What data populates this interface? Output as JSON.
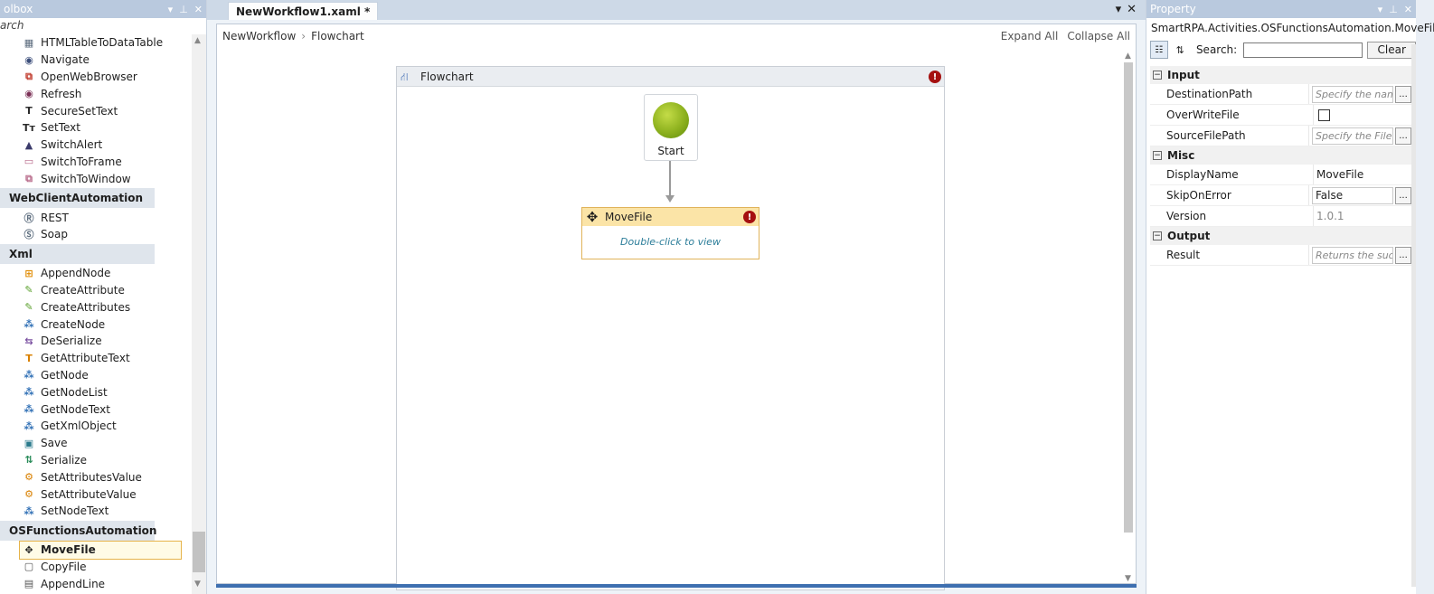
{
  "toolbox": {
    "title": "olbox",
    "search_placeholder": "arch",
    "items": [
      {
        "type": "item",
        "label": "HTMLTableToDataTable",
        "icon": "table-icon",
        "glyph": "▦",
        "color": "#5b6b7d"
      },
      {
        "type": "item",
        "label": "Navigate",
        "icon": "navigate-icon",
        "glyph": "◉",
        "color": "#3b4d7a"
      },
      {
        "type": "item",
        "label": "OpenWebBrowser",
        "icon": "browser-icon",
        "glyph": "⧉",
        "color": "#c0392b"
      },
      {
        "type": "item",
        "label": "Refresh",
        "icon": "refresh-icon",
        "glyph": "◉",
        "color": "#7a2f55"
      },
      {
        "type": "item",
        "label": "SecureSetText",
        "icon": "secure-text-icon",
        "glyph": "T",
        "color": "#2b2b2b"
      },
      {
        "type": "item",
        "label": "SetText",
        "icon": "settext-icon",
        "glyph": "Tт",
        "color": "#2b2b2b"
      },
      {
        "type": "item",
        "label": "SwitchAlert",
        "icon": "alert-icon",
        "glyph": "▲",
        "color": "#3b3b6b"
      },
      {
        "type": "item",
        "label": "SwitchToFrame",
        "icon": "frame-icon",
        "glyph": "▭",
        "color": "#b86a8a"
      },
      {
        "type": "item",
        "label": "SwitchToWindow",
        "icon": "window-icon",
        "glyph": "⧉",
        "color": "#b86a8a"
      },
      {
        "type": "category",
        "label": "WebClientAutomation"
      },
      {
        "type": "item",
        "label": "REST",
        "icon": "rest-icon",
        "glyph": "Ⓡ",
        "color": "#5f6f80"
      },
      {
        "type": "item",
        "label": "Soap",
        "icon": "soap-icon",
        "glyph": "Ⓢ",
        "color": "#5f6f80"
      },
      {
        "type": "category",
        "label": "Xml"
      },
      {
        "type": "item",
        "label": "AppendNode",
        "icon": "append-node-icon",
        "glyph": "⊞",
        "color": "#e08a00"
      },
      {
        "type": "item",
        "label": "CreateAttribute",
        "icon": "pencil-icon",
        "glyph": "✎",
        "color": "#5aa02c"
      },
      {
        "type": "item",
        "label": "CreateAttributes",
        "icon": "pencil-icon",
        "glyph": "✎",
        "color": "#5aa02c"
      },
      {
        "type": "item",
        "label": "CreateNode",
        "icon": "node-icon",
        "glyph": "⁂",
        "color": "#2f6fb5"
      },
      {
        "type": "item",
        "label": "DeSerialize",
        "icon": "deserialize-icon",
        "glyph": "⇆",
        "color": "#7a4fa0"
      },
      {
        "type": "item",
        "label": "GetAttributeText",
        "icon": "text-icon",
        "glyph": "T",
        "color": "#d98000"
      },
      {
        "type": "item",
        "label": "GetNode",
        "icon": "node-icon",
        "glyph": "⁂",
        "color": "#2f6fb5"
      },
      {
        "type": "item",
        "label": "GetNodeList",
        "icon": "node-icon",
        "glyph": "⁂",
        "color": "#2f6fb5"
      },
      {
        "type": "item",
        "label": "GetNodeText",
        "icon": "node-icon",
        "glyph": "⁂",
        "color": "#2f6fb5"
      },
      {
        "type": "item",
        "label": "GetXmlObject",
        "icon": "node-icon",
        "glyph": "⁂",
        "color": "#2f6fb5"
      },
      {
        "type": "item",
        "label": "Save",
        "icon": "save-icon",
        "glyph": "▣",
        "color": "#2a7a8c"
      },
      {
        "type": "item",
        "label": "Serialize",
        "icon": "serialize-icon",
        "glyph": "⇅",
        "color": "#2a8c5a"
      },
      {
        "type": "item",
        "label": "SetAttributesValue",
        "icon": "set-attribute-icon",
        "glyph": "⚙",
        "color": "#d98000"
      },
      {
        "type": "item",
        "label": "SetAttributeValue",
        "icon": "set-attribute-icon",
        "glyph": "⚙",
        "color": "#d98000"
      },
      {
        "type": "item",
        "label": "SetNodeText",
        "icon": "node-icon",
        "glyph": "⁂",
        "color": "#2f6fb5"
      },
      {
        "type": "category",
        "label": "OSFunctionsAutomation"
      },
      {
        "type": "item",
        "label": "MoveFile",
        "icon": "move-icon",
        "glyph": "✥",
        "color": "#1e1e1e",
        "selected": true
      },
      {
        "type": "item",
        "label": "CopyFile",
        "icon": "copy-icon",
        "glyph": "▢",
        "color": "#555555"
      },
      {
        "type": "item",
        "label": "AppendLine",
        "icon": "append-line-icon",
        "glyph": "▤",
        "color": "#555555"
      }
    ]
  },
  "designer": {
    "tab_label": "NewWorkflow1.xaml *",
    "breadcrumb": [
      "NewWorkflow",
      "Flowchart"
    ],
    "expand_all": "Expand All",
    "collapse_all": "Collapse All",
    "flowchart_title": "Flowchart",
    "start_label": "Start",
    "activity": {
      "title": "MoveFile",
      "hint": "Double-click to view"
    },
    "error_mark": "!"
  },
  "property": {
    "title": "Property",
    "type_name": "SmartRPA.Activities.OSFunctionsAutomation.MoveFile",
    "search_label": "Search:",
    "clear_label": "Clear",
    "categories": [
      {
        "name": "Input",
        "rows": [
          {
            "name": "DestinationPath",
            "kind": "text",
            "value": "Specify the nam",
            "placeholder": true
          },
          {
            "name": "OverWriteFile",
            "kind": "check",
            "value": ""
          },
          {
            "name": "SourceFilePath",
            "kind": "text",
            "value": "Specify the File",
            "placeholder": true
          }
        ]
      },
      {
        "name": "Misc",
        "rows": [
          {
            "name": "DisplayName",
            "kind": "plain",
            "value": "MoveFile"
          },
          {
            "name": "SkipOnError",
            "kind": "text",
            "value": "False",
            "placeholder": false
          },
          {
            "name": "Version",
            "kind": "readonly",
            "value": "1.0.1"
          }
        ]
      },
      {
        "name": "Output",
        "rows": [
          {
            "name": "Result",
            "kind": "text",
            "value": "Returns the suc",
            "placeholder": true
          }
        ]
      }
    ]
  }
}
